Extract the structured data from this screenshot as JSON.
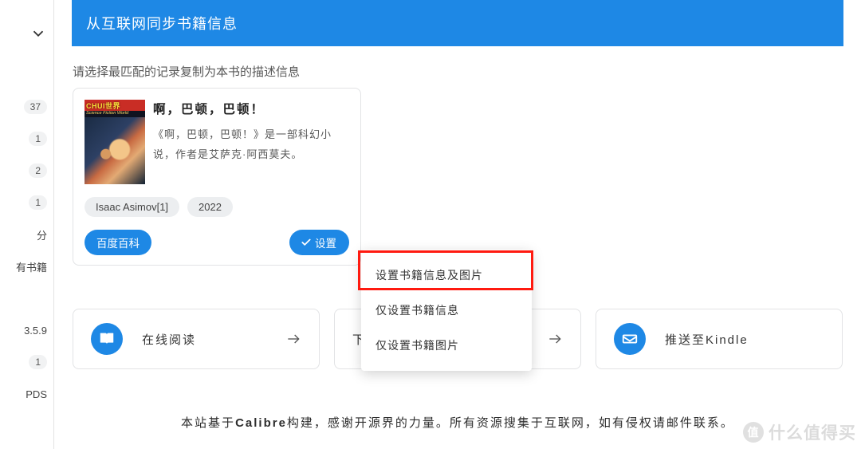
{
  "rail": {
    "badges": [
      "37",
      "1",
      "2",
      "1"
    ],
    "label_part": "分",
    "label_books": "有书籍",
    "version": "3.5.9",
    "badge_last": "1",
    "label_bottom": "PDS"
  },
  "panel": {
    "title": "从互联网同步书籍信息",
    "hint": "请选择最匹配的记录复制为本书的描述信息"
  },
  "card": {
    "thumb_brand": "CHUI世界",
    "thumb_sub": "Science Fiction World",
    "title": "啊，巴顿，巴顿！",
    "desc": "《啊，巴顿，巴顿！》是一部科幻小说，作者是艾萨克·阿西莫夫。",
    "author_chip": "Isaac Asimov[1]",
    "year_chip": "2022",
    "source_tag": "百度百科",
    "set_button": "设置"
  },
  "dropdown": {
    "opt_info_and_image": "设置书籍信息及图片",
    "opt_info_only": "仅设置书籍信息",
    "opt_image_only": "仅设置书籍图片"
  },
  "actions": {
    "read_online": "在线阅读",
    "download": "下载",
    "push_kindle": "推送至Kindle"
  },
  "footer": {
    "prefix": "本站基于",
    "brand": "Calibre",
    "suffix": "构建，感谢开源界的力量。所有资源搜集于互联网，如有侵权请邮件联系。"
  },
  "watermark": {
    "glyph": "值",
    "text": "什么值得买"
  }
}
